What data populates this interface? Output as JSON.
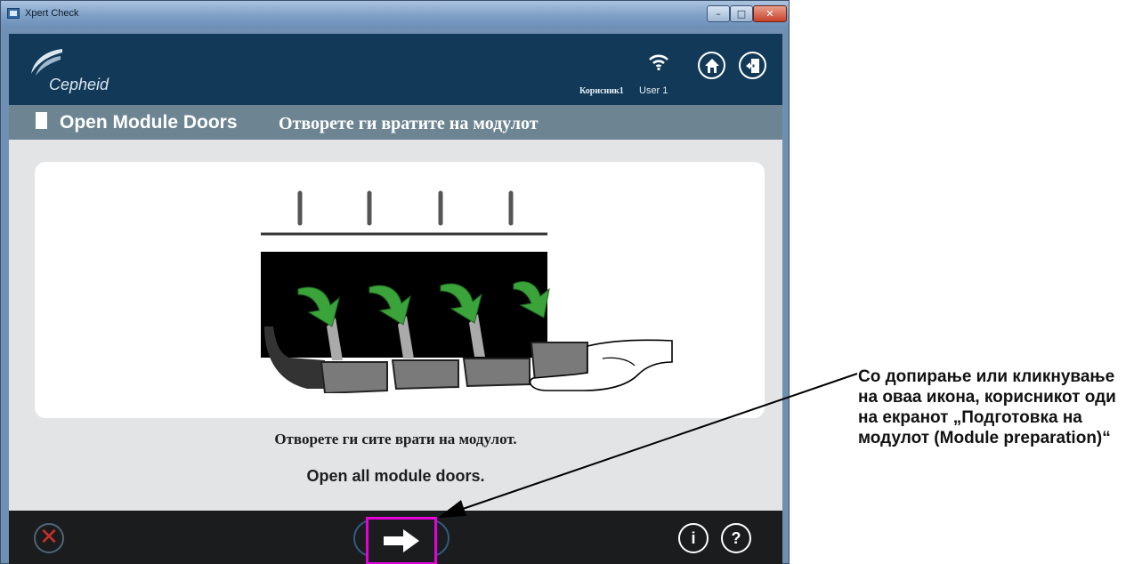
{
  "window": {
    "title": "Xpert Check",
    "controls": {
      "minimize": "–",
      "maximize": "□",
      "close": "✕"
    }
  },
  "header": {
    "logo": "Cepheid",
    "user_label_mk": "Корисник1",
    "user_label_en": "User 1",
    "icons": [
      "wifi-icon",
      "home-icon",
      "exit-icon"
    ]
  },
  "subheader": {
    "title_en": "Open Module Doors",
    "title_mk": "Отворете ги вратите на модулот",
    "icon": "door-icon"
  },
  "main": {
    "illustration": "module-doors-illustration",
    "instruction_mk": "Отворете ги сите врати на модулот.",
    "instruction_en": "Open all module doors."
  },
  "footer": {
    "cancel": "✕",
    "next": "next-arrow-icon",
    "info": "i",
    "help": "?"
  },
  "callout": {
    "text": "Со допирање или кликнување на оваа икона, корисникот оди на екранот „Подготовка на модулот (Module preparation)“"
  },
  "colors": {
    "header_bg": "#123a58",
    "subheader_bg": "#6d8593",
    "content_bg": "#e2e4e5",
    "footer_bg": "#1b1c1d",
    "highlight": "#e600dc",
    "cancel": "#c9302c",
    "arrow_green": "#3aa33a"
  }
}
